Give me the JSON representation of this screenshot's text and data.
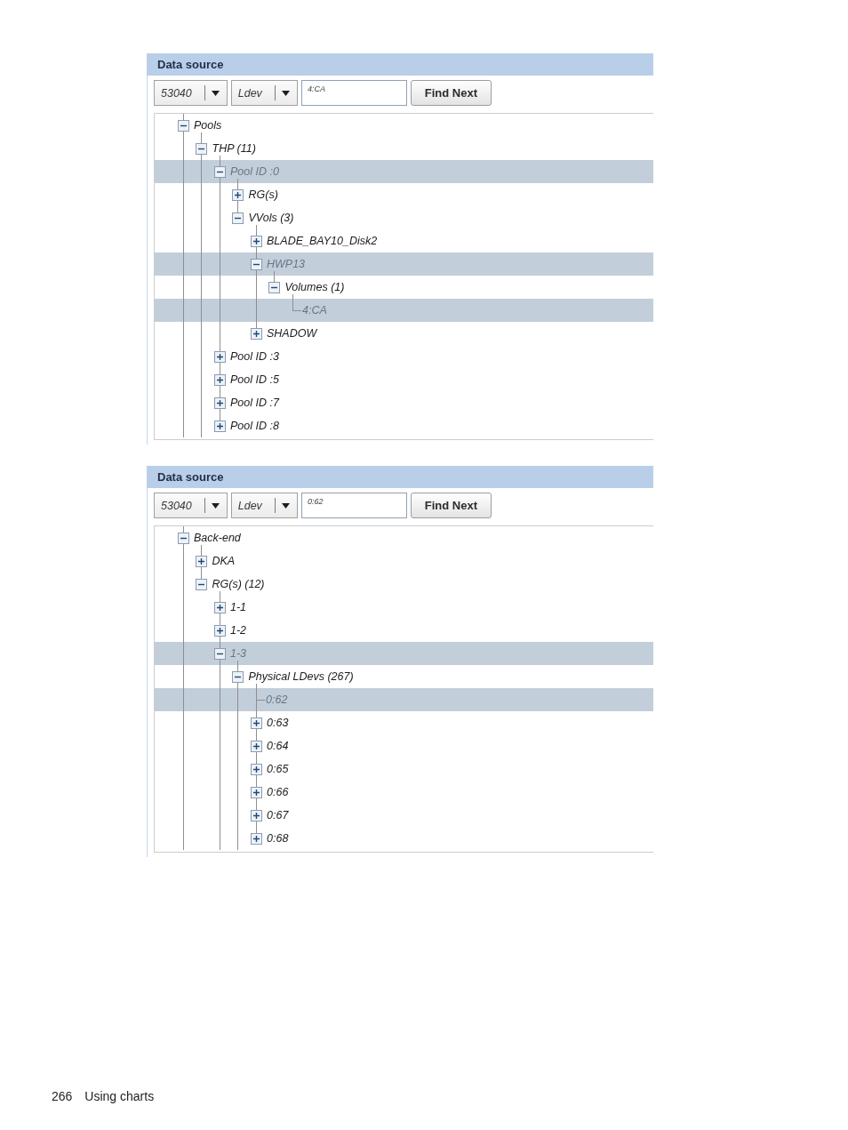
{
  "panels": [
    {
      "title": "Data source",
      "dropdowns": [
        {
          "value": "53040"
        },
        {
          "value": "Ldev"
        }
      ],
      "search": {
        "value": "4:CA"
      },
      "button": "Find Next",
      "tree": [
        {
          "label": "Pools",
          "kind": "folder",
          "expanded": true,
          "selected": false,
          "more_below": true,
          "children": [
            {
              "label": "THP (11)",
              "kind": "folder",
              "expanded": true,
              "selected": false,
              "more_below": true,
              "children": [
                {
                  "label": "Pool ID :0",
                  "kind": "folder",
                  "expanded": true,
                  "selected": true,
                  "children": [
                    {
                      "label": "RG(s)",
                      "kind": "folder",
                      "expanded": false,
                      "selected": false
                    },
                    {
                      "label": "VVols (3)",
                      "kind": "folder",
                      "expanded": true,
                      "selected": false,
                      "children": [
                        {
                          "label": "BLADE_BAY10_Disk2",
                          "kind": "folder",
                          "expanded": false,
                          "selected": false
                        },
                        {
                          "label": "HWP13",
                          "kind": "folder",
                          "expanded": true,
                          "selected": true,
                          "children": [
                            {
                              "label": "Volumes (1)",
                              "kind": "folder",
                              "expanded": true,
                              "selected": false,
                              "children": [
                                {
                                  "label": "4:CA",
                                  "kind": "leaf",
                                  "selected": true
                                }
                              ]
                            }
                          ]
                        },
                        {
                          "label": "SHADOW",
                          "kind": "folder",
                          "expanded": false,
                          "selected": false
                        }
                      ]
                    }
                  ]
                },
                {
                  "label": "Pool ID :3",
                  "kind": "folder",
                  "expanded": false,
                  "selected": false
                },
                {
                  "label": "Pool ID :5",
                  "kind": "folder",
                  "expanded": false,
                  "selected": false
                },
                {
                  "label": "Pool ID :7",
                  "kind": "folder",
                  "expanded": false,
                  "selected": false
                },
                {
                  "label": "Pool ID :8",
                  "kind": "folder",
                  "expanded": false,
                  "selected": false
                }
              ]
            }
          ]
        }
      ]
    },
    {
      "title": "Data source",
      "dropdowns": [
        {
          "value": "53040"
        },
        {
          "value": "Ldev"
        }
      ],
      "search": {
        "value": "0:62"
      },
      "button": "Find Next",
      "tree": [
        {
          "label": "Back-end",
          "kind": "folder",
          "expanded": true,
          "selected": false,
          "more_below": true,
          "children": [
            {
              "label": "DKA",
              "kind": "folder",
              "expanded": false,
              "selected": false
            },
            {
              "label": "RG(s) (12)",
              "kind": "folder",
              "expanded": true,
              "selected": false,
              "children": [
                {
                  "label": "1-1",
                  "kind": "folder",
                  "expanded": false,
                  "selected": false
                },
                {
                  "label": "1-2",
                  "kind": "folder",
                  "expanded": false,
                  "selected": false
                },
                {
                  "label": "1-3",
                  "kind": "folder",
                  "expanded": true,
                  "selected": true,
                  "more_below": true,
                  "children": [
                    {
                      "label": "Physical LDevs (267)",
                      "kind": "folder",
                      "expanded": true,
                      "selected": false,
                      "more_below": true,
                      "children": [
                        {
                          "label": "0:62",
                          "kind": "leaf",
                          "selected": true
                        },
                        {
                          "label": "0:63",
                          "kind": "folder",
                          "expanded": false,
                          "selected": false
                        },
                        {
                          "label": "0:64",
                          "kind": "folder",
                          "expanded": false,
                          "selected": false
                        },
                        {
                          "label": "0:65",
                          "kind": "folder",
                          "expanded": false,
                          "selected": false
                        },
                        {
                          "label": "0:66",
                          "kind": "folder",
                          "expanded": false,
                          "selected": false
                        },
                        {
                          "label": "0:67",
                          "kind": "folder",
                          "expanded": false,
                          "selected": false
                        },
                        {
                          "label": "0:68",
                          "kind": "folder",
                          "expanded": false,
                          "selected": false
                        }
                      ]
                    }
                  ]
                }
              ]
            }
          ]
        }
      ]
    }
  ],
  "footer": {
    "page_number": "266",
    "section": "Using charts"
  }
}
